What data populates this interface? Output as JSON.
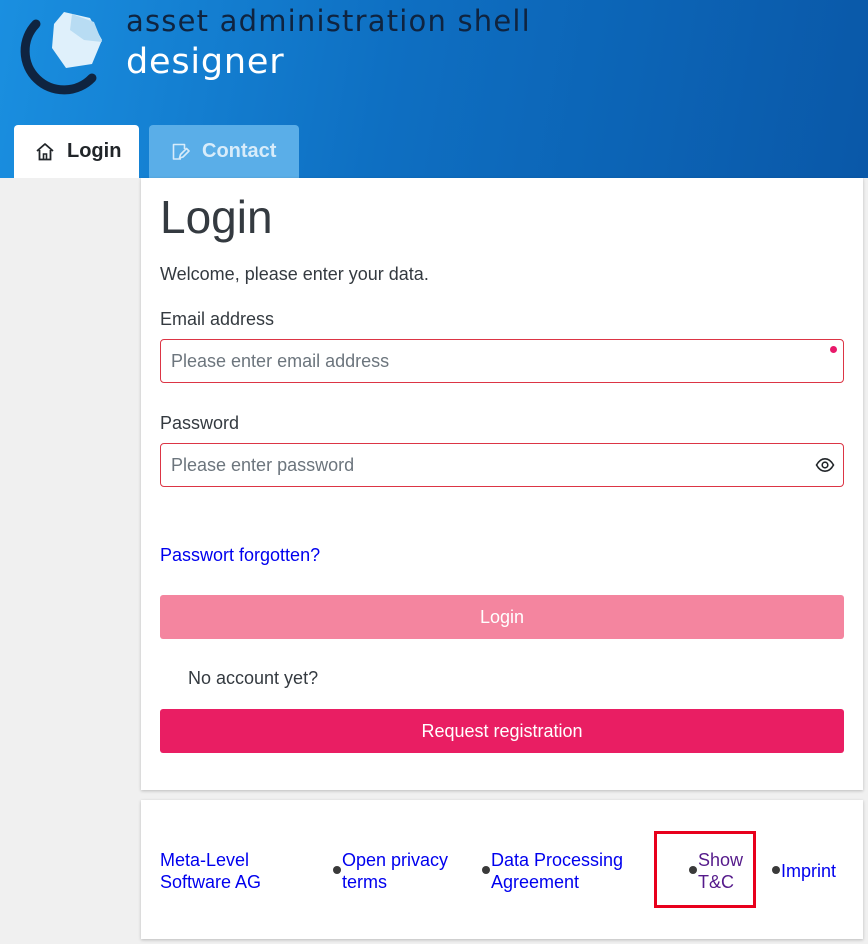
{
  "header": {
    "brand_line1": "asset administration shell",
    "brand_line2": "designer",
    "colors": {
      "gradient_start": "#1a8fe0",
      "gradient_end": "#0a58a8",
      "logo_ring": "#0f2440"
    }
  },
  "tabs": [
    {
      "label": "Login",
      "icon": "home-icon",
      "active": true
    },
    {
      "label": "Contact",
      "icon": "edit-icon",
      "active": false
    }
  ],
  "login_form": {
    "title": "Login",
    "welcome": "Welcome, please enter your data.",
    "email": {
      "label": "Email address",
      "placeholder": "Please enter email address",
      "value": ""
    },
    "password": {
      "label": "Password",
      "placeholder": "Please enter password",
      "value": ""
    },
    "forgot_link": "Passwort forgotten?",
    "login_button": "Login",
    "no_account_text": "No account yet?",
    "register_button": "Request registration",
    "colors": {
      "accent": "#e91e63",
      "accent_disabled": "#f4859f",
      "error_border": "#dc3545"
    }
  },
  "footer": {
    "links": [
      {
        "line1": "Meta-Level",
        "line2": "Software AG"
      },
      {
        "line1": "Open privacy",
        "line2": "terms"
      },
      {
        "line1": "Data Processing",
        "line2": "Agreement"
      },
      {
        "line1": "Show",
        "line2": "T&C"
      },
      {
        "line1": "Imprint",
        "line2": ""
      }
    ],
    "colors": {
      "link": "#0000ee",
      "visited": "#551a8b",
      "highlight": "#e8001c"
    }
  }
}
